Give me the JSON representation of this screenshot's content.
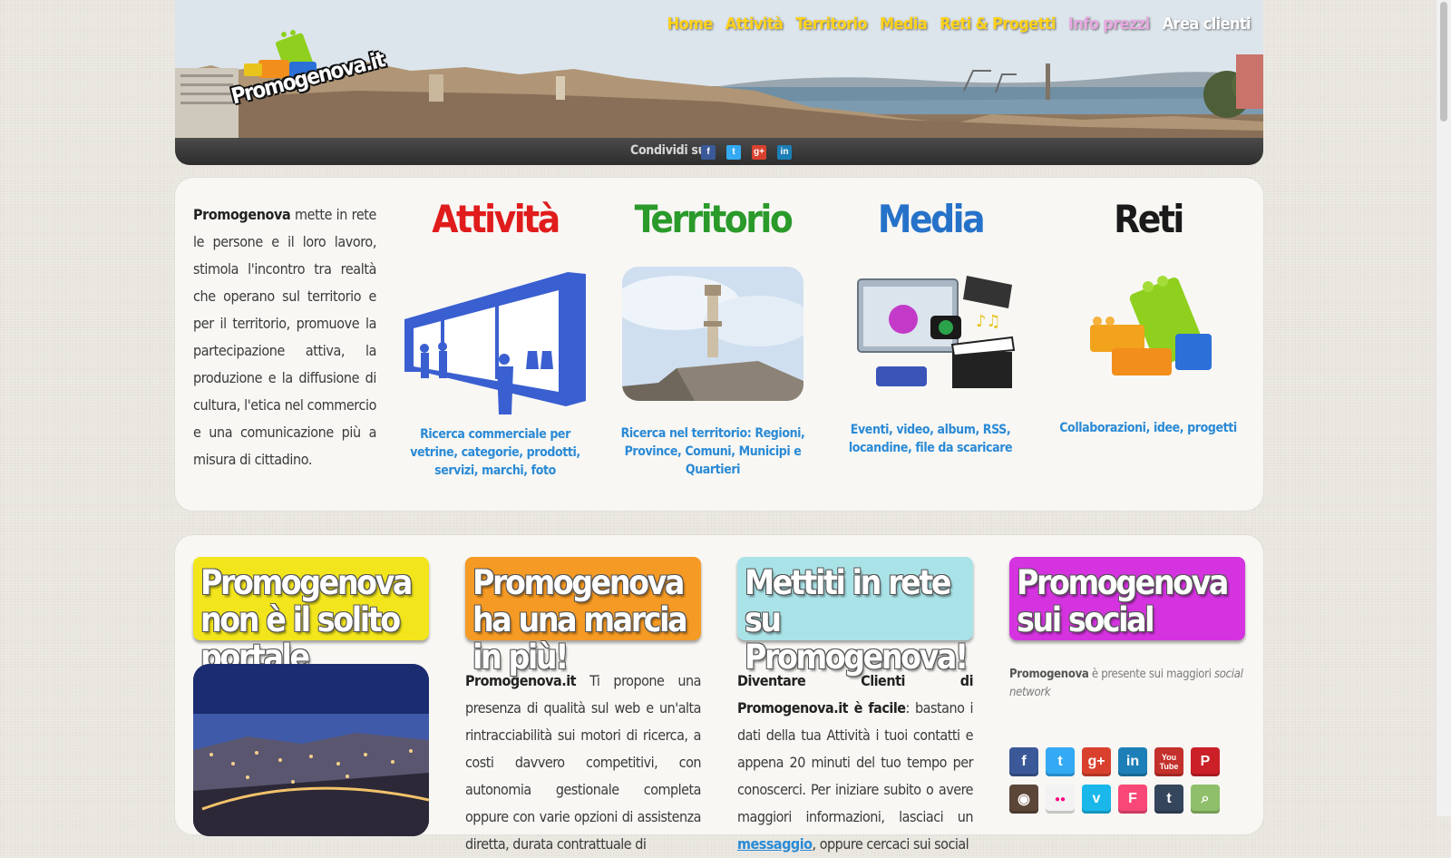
{
  "header": {
    "logo_text": "Promogenova.it",
    "nav": [
      {
        "label": "Home",
        "color": "#ffd21a"
      },
      {
        "label": "Attività",
        "color": "#ffd21a"
      },
      {
        "label": "Territorio",
        "color": "#ffd21a"
      },
      {
        "label": "Media",
        "color": "#ffd21a"
      },
      {
        "label": "Reti & Progetti",
        "color": "#ffd21a"
      },
      {
        "label": "Info prezzi",
        "color": "#e8a8e0"
      },
      {
        "label": "Area clienti",
        "color": "#ffffff"
      }
    ],
    "share_label": "Condividi su",
    "share_icons": [
      "facebook-icon",
      "twitter-icon",
      "google-plus-icon",
      "linkedin-icon"
    ]
  },
  "intro": {
    "brand": "Promogenova",
    "text": " mette in rete le persone e il loro lavoro, stimola l'incontro tra realtà che operano sul territorio e per il territorio, promuove la partecipazione attiva, la produzione e la diffusione di cultura, l'etica nel commercio e una comunicazione più a misura di cittadino."
  },
  "categories": [
    {
      "title": "Attività",
      "color": "#e01c1c",
      "desc": "Ricerca commerciale per vetrine, categorie, prodotti, servizi, marchi, foto",
      "icon": "shopfront-icon"
    },
    {
      "title": "Territorio",
      "color": "#2a9a2a",
      "desc": "Ricerca nel territorio: Regioni, Province, Comuni, Municipi e Quartieri",
      "icon": "lighthouse-icon"
    },
    {
      "title": "Media",
      "color": "#2672c9",
      "desc": "Eventi, video, album, RSS, locandine, file da scaricare",
      "icon": "media-icon"
    },
    {
      "title": "Reti",
      "color": "#1a1a1a",
      "desc": "Collaborazioni, idee, progetti",
      "icon": "bricks-icon"
    }
  ],
  "boxes": [
    {
      "title": "Promogenova non è il solito portale",
      "color": "#f2e51c"
    },
    {
      "title": "Promogenova ha una marcia in più!",
      "color": "#f59a24",
      "body_brand": "Promogenova.it",
      "body_text": " Ti propone una presenza di qualità sul web e un'alta rintracciabilità sui motori di ricerca, a costi davvero competitivi, con autonomia gestionale completa oppure con varie opzioni di assistenza diretta, durata contrattuale di"
    },
    {
      "title": "Mettiti in rete su Promogenova!",
      "color": "#a9e3e8",
      "body_bold": "Diventare Clienti di Promogenova.it è facile",
      "body_text": ": bastano i dati della tua Attività i tuoi contatti e appena 20 minuti del tuo tempo per conoscerci. Per iniziare subito o avere maggiori informazioni, lasciaci un ",
      "body_link": "messaggio",
      "body_tail": ", oppure cercaci sui social"
    },
    {
      "title": "Promogenova sui social",
      "color": "#d533e0",
      "note_brand": "Promogenova",
      "note_text": " è presente sui maggiori ",
      "note_em": "social network"
    }
  ],
  "social_icons": [
    {
      "name": "facebook-icon",
      "glyph": "f",
      "color": "#3b5998"
    },
    {
      "name": "twitter-icon",
      "glyph": "t",
      "color": "#33aaf3"
    },
    {
      "name": "google-plus-icon",
      "glyph": "g+",
      "color": "#d9412e"
    },
    {
      "name": "linkedin-icon",
      "glyph": "in",
      "color": "#1d7fb7"
    },
    {
      "name": "youtube-icon",
      "glyph": "You Tube",
      "color": "#c4302b"
    },
    {
      "name": "pinterest-icon",
      "glyph": "P",
      "color": "#cb2027"
    },
    {
      "name": "instagram-icon",
      "glyph": "◉",
      "color": "#5b4638"
    },
    {
      "name": "flickr-icon",
      "glyph": "●●",
      "color": "#f2f2f2"
    },
    {
      "name": "vimeo-icon",
      "glyph": "v",
      "color": "#1ab7ea"
    },
    {
      "name": "foursquare-icon",
      "glyph": "F",
      "color": "#f94877"
    },
    {
      "name": "tumblr-icon",
      "glyph": "t",
      "color": "#35465c"
    },
    {
      "name": "map-search-icon",
      "glyph": "⌕",
      "color": "#8fbf6a"
    }
  ]
}
